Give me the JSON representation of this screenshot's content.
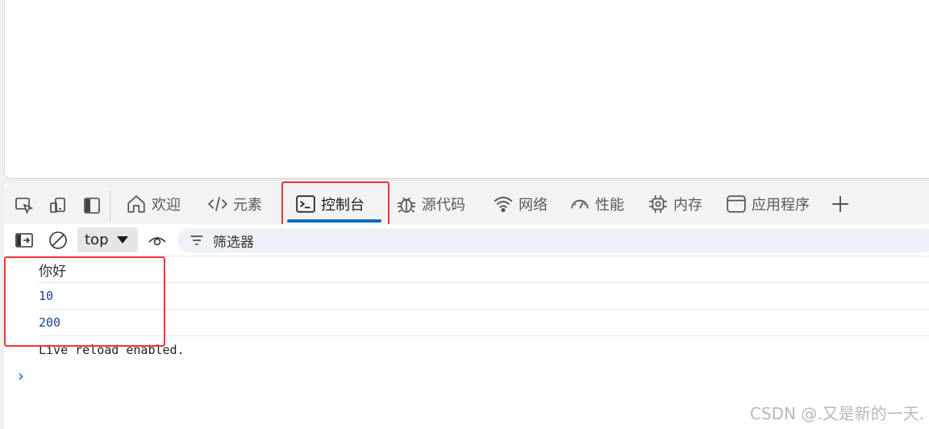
{
  "devtools": {
    "tabs": [
      {
        "label": "欢迎",
        "icon": "home-icon"
      },
      {
        "label": "元素",
        "icon": "code-icon"
      },
      {
        "label": "控制台",
        "icon": "terminal-icon"
      },
      {
        "label": "源代码",
        "icon": "bug-icon"
      },
      {
        "label": "网络",
        "icon": "wifi-icon"
      },
      {
        "label": "性能",
        "icon": "gauge-icon"
      },
      {
        "label": "内存",
        "icon": "chip-icon"
      },
      {
        "label": "应用程序",
        "icon": "window-icon"
      }
    ],
    "active_tab": "控制台",
    "accent_color": "#0f6cbd",
    "annotation_color": "#e8393a"
  },
  "console": {
    "context": "top",
    "filter_placeholder": "筛选器",
    "messages": [
      {
        "text": "你好"
      },
      {
        "text": "10"
      },
      {
        "text": "200"
      },
      {
        "text": "Live reload enabled."
      }
    ],
    "prompt": "›"
  },
  "watermark": "CSDN @.又是新的一天."
}
